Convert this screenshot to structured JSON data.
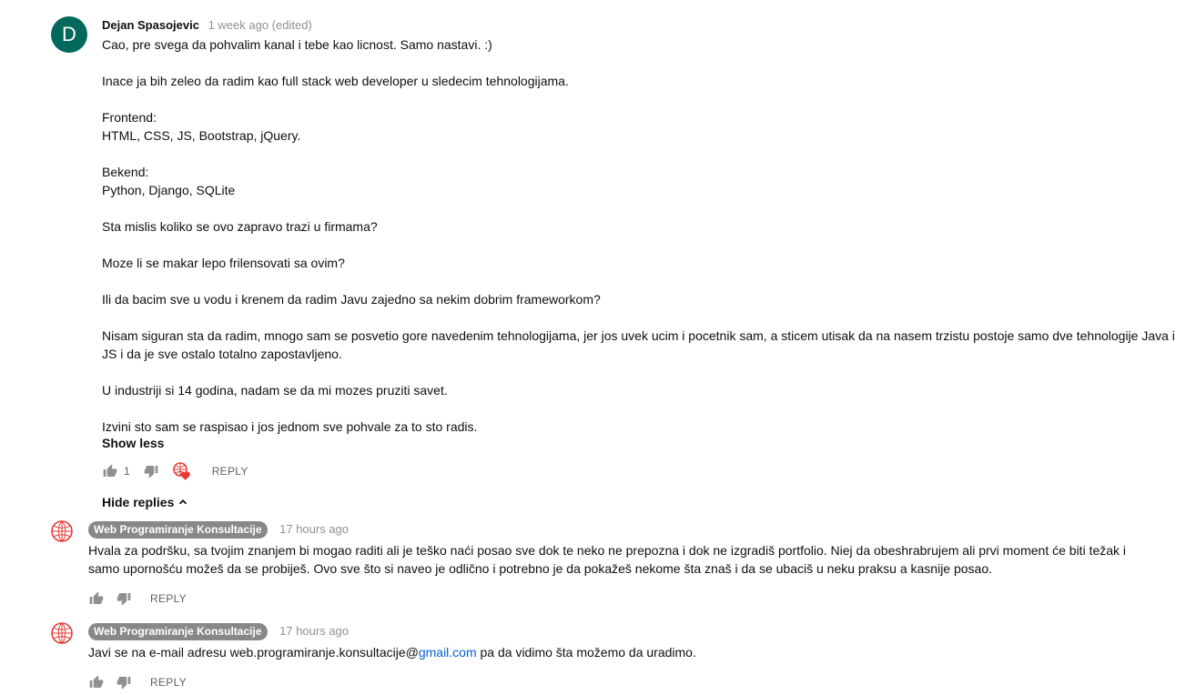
{
  "comment": {
    "avatar_letter": "D",
    "avatar_color": "#00695c",
    "author": "Dejan Spasojevic",
    "time": "1 week ago (edited)",
    "paragraphs": [
      "Cao, pre svega da pohvalim kanal i tebe kao licnost. Samo nastavi. :)",
      "",
      "Inace ja bih zeleo da radim kao full stack web developer u sledecim tehnologijama.",
      "",
      "Frontend:",
      "HTML, CSS,  JS, Bootstrap, jQuery.",
      "",
      "Bekend:",
      "Python, Django, SQLite",
      "",
      "Sta mislis koliko se ovo zapravo trazi u firmama?",
      "",
      "Moze li se makar lepo frilensovati sa ovim?",
      "",
      "Ili da bacim sve u vodu i krenem da radim Javu zajedno sa nekim dobrim frameworkom?",
      "",
      "Nisam siguran sta da radim, mnogo sam se posvetio gore navedenim tehnologijama, jer jos uvek ucim i pocetnik sam, a sticem utisak da na nasem trzistu postoje samo dve tehnologije Java i",
      "JS i da je sve ostalo totalno zapostavljeno.",
      "",
      "U industriji si 14 godina, nadam se da mi mozes pruziti savet.",
      "",
      "Izvini sto sam se raspisao i jos jednom sve pohvale za to sto radis."
    ],
    "show_less": "Show less",
    "like_count": "1",
    "reply_label": "REPLY",
    "hide_replies": "Hide replies"
  },
  "replies": [
    {
      "author": "Web Programiranje Konsultacije",
      "time": "17 hours ago",
      "lines": [
        "Hvala za podršku, sa tvojim znanjem bi mogao raditi ali je teško naći posao sve dok te neko ne prepozna i dok ne izgradiš portfolio. Niej da obeshrabrujem ali prvi moment će biti težak i",
        "samo upornošću možeš da se probiješ. Ovo sve što si naveo je odlično i potrebno je da pokažeš nekome šta znaš i da se ubaciš u neku praksu a kasnije posao."
      ],
      "reply_label": "REPLY"
    },
    {
      "author": "Web Programiranje Konsultacije",
      "time": "17 hours ago",
      "text_before": "Javi se na e-mail adresu web.programiranje.konsultacije@",
      "link": "gmail.com",
      "text_after": " pa da vidimo šta možemo da uradimo.",
      "reply_label": "REPLY"
    }
  ],
  "colors": {
    "accent_link": "#065fd4",
    "badge_bg": "#888888",
    "meta_text": "#909090",
    "heart": "#e53935"
  },
  "icons": [
    "thumb-up-icon",
    "thumb-down-icon",
    "creator-heart-icon",
    "chevron-up-icon",
    "channel-globe-icon"
  ]
}
